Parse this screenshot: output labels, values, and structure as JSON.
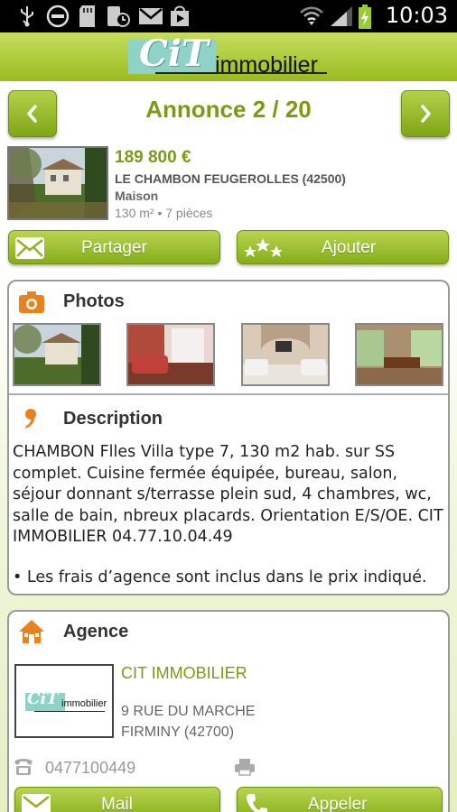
{
  "status_bar": {
    "time": "10:03",
    "icons": [
      "usb-icon",
      "do-not-disturb-icon",
      "sd-card-icon",
      "schedule-icon",
      "gmail-icon",
      "play-store-icon",
      "wifi-icon",
      "signal-icon",
      "battery-charging-icon"
    ]
  },
  "header": {
    "logo_brand": "CiT",
    "logo_text": "immobilier"
  },
  "nav": {
    "title": "Annonce 2 / 20",
    "prev_icon": "chevron-left-icon",
    "next_icon": "chevron-right-icon"
  },
  "listing": {
    "price": "189 800 €",
    "city": "LE CHAMBON FEUGEROLLES (42500)",
    "type": "Maison",
    "specs": "130 m² • 7 pièces"
  },
  "actions": {
    "share_label": "Partager",
    "add_label": "Ajouter"
  },
  "photos": {
    "title": "Photos",
    "items": [
      "photo-exterior",
      "photo-bedroom",
      "photo-living-room",
      "photo-dining-room"
    ]
  },
  "description": {
    "title": "Description",
    "text": "CHAMBON Flles Villa type 7, 130 m2 hab. sur SS complet. Cuisine fermée équipée, bureau, salon, séjour donnant s/terrasse plein sud, 4 chambres, wc, salle de bain, nbreux placards. Orientation E/S/OE. CIT IMMOBILIER  04.77.10.04.49",
    "fees_note": "• Les frais d’agence sont inclus dans le prix indiqué."
  },
  "agency": {
    "title": "Agence",
    "name": "CIT IMMOBILIER",
    "street": "9 RUE DU MARCHE",
    "city": "FIRMINY (42700)",
    "phone": "0477100449",
    "logo_brand": "CiT",
    "logo_text": "immobilier",
    "mail_label": "Mail",
    "call_label": "Appeler"
  },
  "colors": {
    "accent_green": "#7a9b12",
    "button_green": "#9cc22b",
    "orange": "#e8821e"
  }
}
